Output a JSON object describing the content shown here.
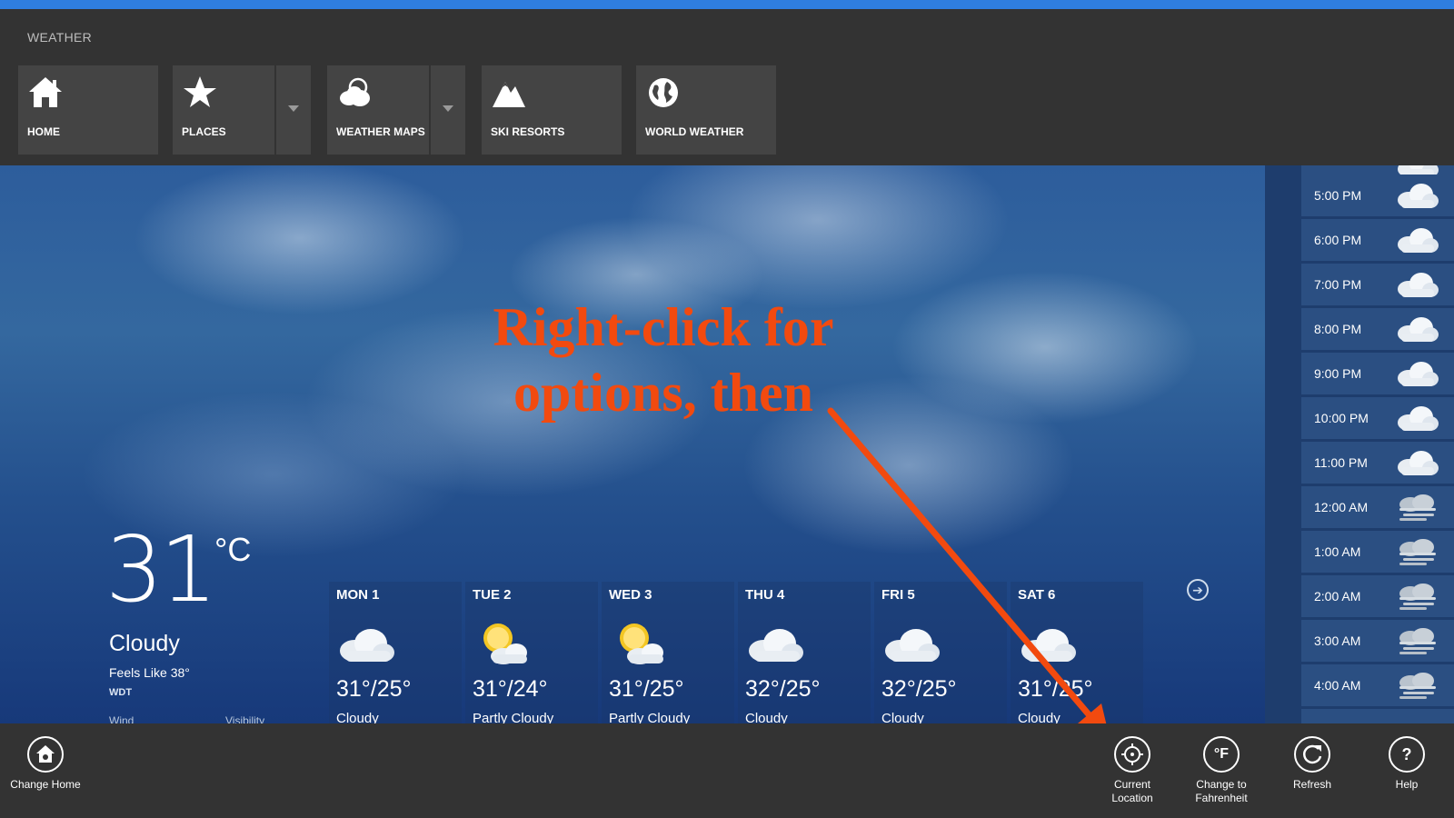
{
  "app": {
    "title": "WEATHER"
  },
  "nav": [
    {
      "label": "HOME",
      "icon": "home-icon"
    },
    {
      "label": "PLACES",
      "icon": "star-icon"
    },
    {
      "label": "WEATHER MAPS",
      "icon": "weather-maps-icon"
    },
    {
      "label": "SKI RESORTS",
      "icon": "mountain-icon"
    },
    {
      "label": "WORLD WEATHER",
      "icon": "globe-icon"
    }
  ],
  "current": {
    "temp": "31",
    "unit": "°C",
    "condition": "Cloudy",
    "feels_like": "Feels Like 38°",
    "station": "WDT",
    "wind_label": "Wind",
    "visibility_label": "Visibility"
  },
  "forecast": [
    {
      "day": "MON 1",
      "temps": "31°/25°",
      "condition": "Cloudy",
      "icon": "cloudy-icon"
    },
    {
      "day": "TUE 2",
      "temps": "31°/24°",
      "condition": "Partly Cloudy",
      "icon": "partly-cloudy-icon"
    },
    {
      "day": "WED 3",
      "temps": "31°/25°",
      "condition": "Partly Cloudy",
      "icon": "partly-cloudy-icon"
    },
    {
      "day": "THU 4",
      "temps": "32°/25°",
      "condition": "Cloudy",
      "icon": "cloudy-icon"
    },
    {
      "day": "FRI 5",
      "temps": "32°/25°",
      "condition": "Cloudy",
      "icon": "cloudy-icon"
    },
    {
      "day": "SAT 6",
      "temps": "31°/25°",
      "condition": "Cloudy",
      "icon": "cloudy-icon"
    }
  ],
  "hourly": [
    {
      "time": "5:00 PM",
      "icon": "cloudy-icon"
    },
    {
      "time": "6:00 PM",
      "icon": "cloudy-icon"
    },
    {
      "time": "7:00 PM",
      "icon": "cloudy-icon"
    },
    {
      "time": "8:00 PM",
      "icon": "cloudy-icon"
    },
    {
      "time": "9:00 PM",
      "icon": "cloudy-icon"
    },
    {
      "time": "10:00 PM",
      "icon": "cloudy-icon"
    },
    {
      "time": "11:00 PM",
      "icon": "cloudy-icon"
    },
    {
      "time": "12:00 AM",
      "icon": "fog-icon"
    },
    {
      "time": "1:00 AM",
      "icon": "fog-icon"
    },
    {
      "time": "2:00 AM",
      "icon": "fog-icon"
    },
    {
      "time": "3:00 AM",
      "icon": "fog-icon"
    },
    {
      "time": "4:00 AM",
      "icon": "fog-icon"
    }
  ],
  "annotation": {
    "line1": "Right-click for",
    "line2": "options, then",
    "color": "#f24a0f"
  },
  "appbar": {
    "change_home": "Change Home",
    "current_location_1": "Current",
    "current_location_2": "Location",
    "change_to_f_1": "Change to",
    "change_to_f_2": "Fahrenheit",
    "refresh": "Refresh",
    "help": "Help",
    "fahrenheit_glyph": "°F",
    "help_glyph": "?"
  },
  "colors": {
    "accent": "#2f7ee0",
    "hourly_bg": "#2b4f82",
    "chrome": "#333333"
  }
}
